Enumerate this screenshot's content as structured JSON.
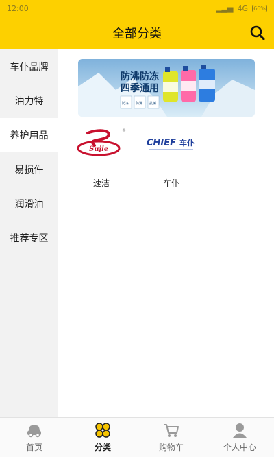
{
  "statusbar": {
    "time": "12:00",
    "network": "4G",
    "battery_percent": "66%"
  },
  "header": {
    "title": "全部分类",
    "search_icon": "search-icon"
  },
  "sidebar": {
    "items": [
      {
        "label": "车仆品牌"
      },
      {
        "label": "油力特"
      },
      {
        "label": "养护用品"
      },
      {
        "label": "易损件"
      },
      {
        "label": "润滑油"
      },
      {
        "label": "推荐专区"
      }
    ],
    "active_index": 2
  },
  "banner": {
    "headline1": "防沸防冻",
    "headline2": "四季通用",
    "tags": [
      "防冻",
      "防沸",
      "抗垢"
    ]
  },
  "brands": [
    {
      "name": "速洁",
      "logo_text": "Sujie"
    },
    {
      "name": "车仆",
      "logo_text": "CHIEF",
      "logo_text_cn": "车仆"
    }
  ],
  "tabbar": {
    "tabs": [
      {
        "label": "首页",
        "icon": "car-icon"
      },
      {
        "label": "分类",
        "icon": "category-grid-icon"
      },
      {
        "label": "购物车",
        "icon": "cart-icon"
      },
      {
        "label": "个人中心",
        "icon": "user-icon"
      }
    ],
    "active_index": 1
  },
  "colors": {
    "brand_yellow": "#fdd000",
    "sidebar_bg": "#f2f2f2"
  }
}
